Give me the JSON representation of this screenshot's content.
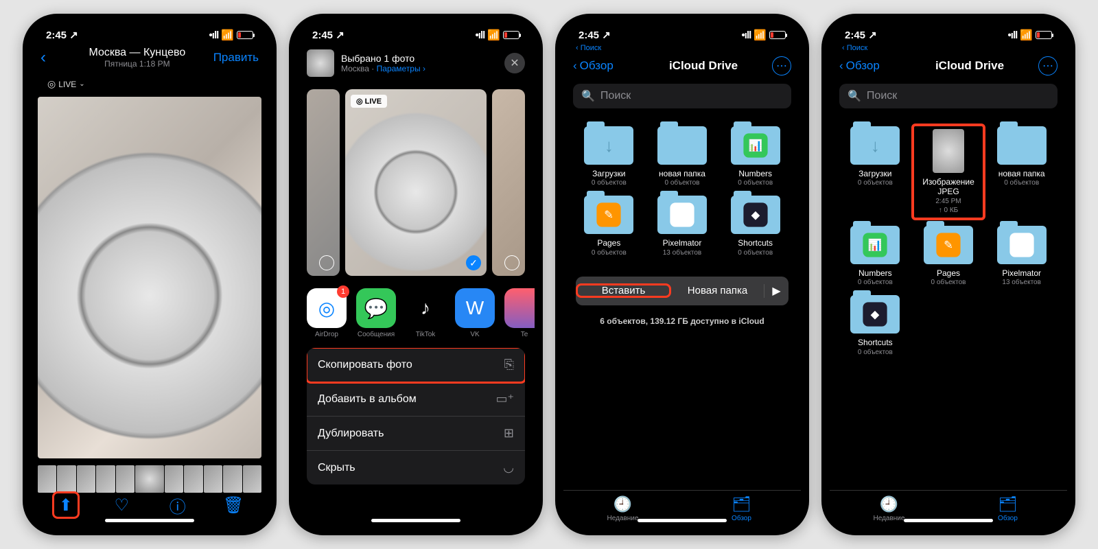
{
  "status": {
    "time": "2:45",
    "arrow": "↗"
  },
  "p1": {
    "title": "Москва — Кунцево",
    "subtitle": "Пятница 1:18 PM",
    "edit": "Править",
    "live": "LIVE"
  },
  "p2": {
    "title": "Выбрано 1 фото",
    "loc": "Москва",
    "params": "Параметры",
    "live": "LIVE",
    "check": "✓",
    "apps": [
      {
        "name": "AirDrop",
        "bg": "#fff",
        "glyph": "◎",
        "color": "#0a84ff",
        "badge": "1"
      },
      {
        "name": "Сообщения",
        "bg": "#34c759",
        "glyph": "💬",
        "color": "#fff"
      },
      {
        "name": "TikTok",
        "bg": "#000",
        "glyph": "♪",
        "color": "#fff"
      },
      {
        "name": "VK",
        "bg": "#2787f5",
        "glyph": "W",
        "color": "#fff"
      },
      {
        "name": "Te",
        "bg": "linear-gradient(#ff5f6d,#845ec2)",
        "glyph": "",
        "color": "#fff"
      }
    ],
    "actions": [
      {
        "label": "Скопировать фото",
        "icon": "⎘",
        "hl": true
      },
      {
        "label": "Добавить в альбом",
        "icon": "▭⁺"
      },
      {
        "label": "Дублировать",
        "icon": "⊞"
      },
      {
        "label": "Скрыть",
        "icon": "◡"
      }
    ]
  },
  "files": {
    "breadcrumb": "Поиск",
    "back": "Обзор",
    "title": "iCloud Drive",
    "search": "Поиск",
    "footer": "6 объектов, 139.12 ГБ доступно в iCloud",
    "ctx_paste": "Вставить",
    "ctx_newfolder": "Новая папка",
    "tab_recent": "Недавние",
    "tab_browse": "Обзор"
  },
  "p3_items": [
    {
      "type": "folder",
      "name": "Загрузки",
      "meta": "0 объектов",
      "icon": "↓"
    },
    {
      "type": "folder",
      "name": "новая папка",
      "meta": "0 объектов"
    },
    {
      "type": "app",
      "name": "Numbers",
      "meta": "0 объектов",
      "bg": "#34c759",
      "glyph": "📊"
    },
    {
      "type": "app",
      "name": "Pages",
      "meta": "0 объектов",
      "bg": "#ff9500",
      "glyph": "✎"
    },
    {
      "type": "app",
      "name": "Pixelmator",
      "meta": "13 объектов",
      "bg": "#fff",
      "glyph": "◕"
    },
    {
      "type": "app",
      "name": "Shortcuts",
      "meta": "0 объектов",
      "bg": "#1c1c2e",
      "glyph": "◆"
    }
  ],
  "p4_items": [
    {
      "type": "folder",
      "name": "Загрузки",
      "meta": "0 объектов",
      "icon": "↓"
    },
    {
      "type": "image",
      "name": "Изображение JPEG",
      "meta": "2:45 PM\n↑ 0 КБ",
      "hl": true
    },
    {
      "type": "folder",
      "name": "новая папка",
      "meta": "0 объектов"
    },
    {
      "type": "app",
      "name": "Numbers",
      "meta": "0 объектов",
      "bg": "#34c759",
      "glyph": "📊"
    },
    {
      "type": "app",
      "name": "Pages",
      "meta": "0 объектов",
      "bg": "#ff9500",
      "glyph": "✎"
    },
    {
      "type": "app",
      "name": "Pixelmator",
      "meta": "13 объектов",
      "bg": "#fff",
      "glyph": "◕"
    },
    {
      "type": "app",
      "name": "Shortcuts",
      "meta": "0 объектов",
      "bg": "#1c1c2e",
      "glyph": "◆"
    }
  ]
}
